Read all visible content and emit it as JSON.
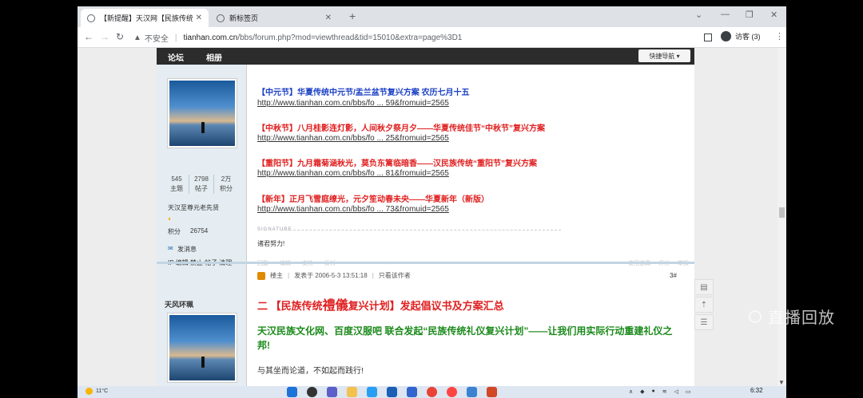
{
  "browser": {
    "tabs": [
      {
        "label": "【新提醒】天汉网【民族传统礼...",
        "active": true
      },
      {
        "label": "新标签页",
        "active": false
      }
    ],
    "new_tab_symbol": "+",
    "address": {
      "security": "不安全",
      "host": "tianhan.com.cn",
      "path": "/bbs/forum.php?mod=viewthread&tid=15010&extra=page%3D1"
    },
    "profile_label": "访客 (3)"
  },
  "forum": {
    "nav": [
      "论坛",
      "相册"
    ],
    "quick_nav": "快捷导航 ▾"
  },
  "user1": {
    "stats": [
      {
        "value": "545",
        "label": "主题"
      },
      {
        "value": "2798",
        "label": "帖子"
      },
      {
        "value": "2万",
        "label": "积分"
      }
    ],
    "rank": "天汉至尊元老先贤",
    "points_label": "积分",
    "points_value": "26754",
    "send_msg": "发消息",
    "admin_links": "IP  编辑  禁止  帖子  清理"
  },
  "post1": {
    "items": [
      {
        "title": "【中元节】华夏传统中元节/盂兰盆节复兴方案 农历七月十五",
        "color": "#1a3fc4",
        "link": "http://www.tianhan.com.cn/bbs/fo ... 59&fromuid=2565"
      },
      {
        "title": "【中秋节】八月桂影连灯影，人间秋夕祭月夕——华夏传统佳节“中秋节”复兴方案",
        "color": "#e02020",
        "link": "http://www.tianhan.com.cn/bbs/fo ... 25&fromuid=2565"
      },
      {
        "title": "【重阳节】九月霜菊涵秋光，莫负东篱临暗香——汉民族传统“重阳节”复兴方案",
        "color": "#e02020",
        "link": "http://www.tianhan.com.cn/bbs/fo ... 81&fromuid=2565"
      },
      {
        "title": "【新年】正月飞雪庭缭光，元夕笙动春未央——华夏新年（新版）",
        "color": "#e02020",
        "link": "http://www.tianhan.com.cn/bbs/fo ... 73&fromuid=2565"
      }
    ],
    "signature_label": "SIGNATURE",
    "signature": "诸君努力!",
    "actions_left": [
      "回复",
      "编辑",
      "支持",
      "反对",
      "举报"
    ],
    "actions_right": [
      "使用道具",
      "评分",
      "举报"
    ]
  },
  "user2": {
    "name": "天风环珮"
  },
  "post2": {
    "author_badge": "楼主",
    "posted": "发表于 2006-5-3 13:51:18",
    "only_author": "只看该作者",
    "floor": "3#",
    "headline_prefix": "二 【民族传统",
    "headline_big": "禮儀",
    "headline_suffix": "复兴计划】发起倡议书及方案汇总",
    "subheadline": "天汉民族文化网、百度汉服吧 联合发起“民族传统礼仪复兴计划”——让我们用实际行动重建礼仪之邦!",
    "cut_line": "与其坐而论道，不如起而践行!"
  },
  "overlay": {
    "watermark": "直播回放"
  },
  "taskbar": {
    "weather": "11°C",
    "time": "6:32"
  }
}
